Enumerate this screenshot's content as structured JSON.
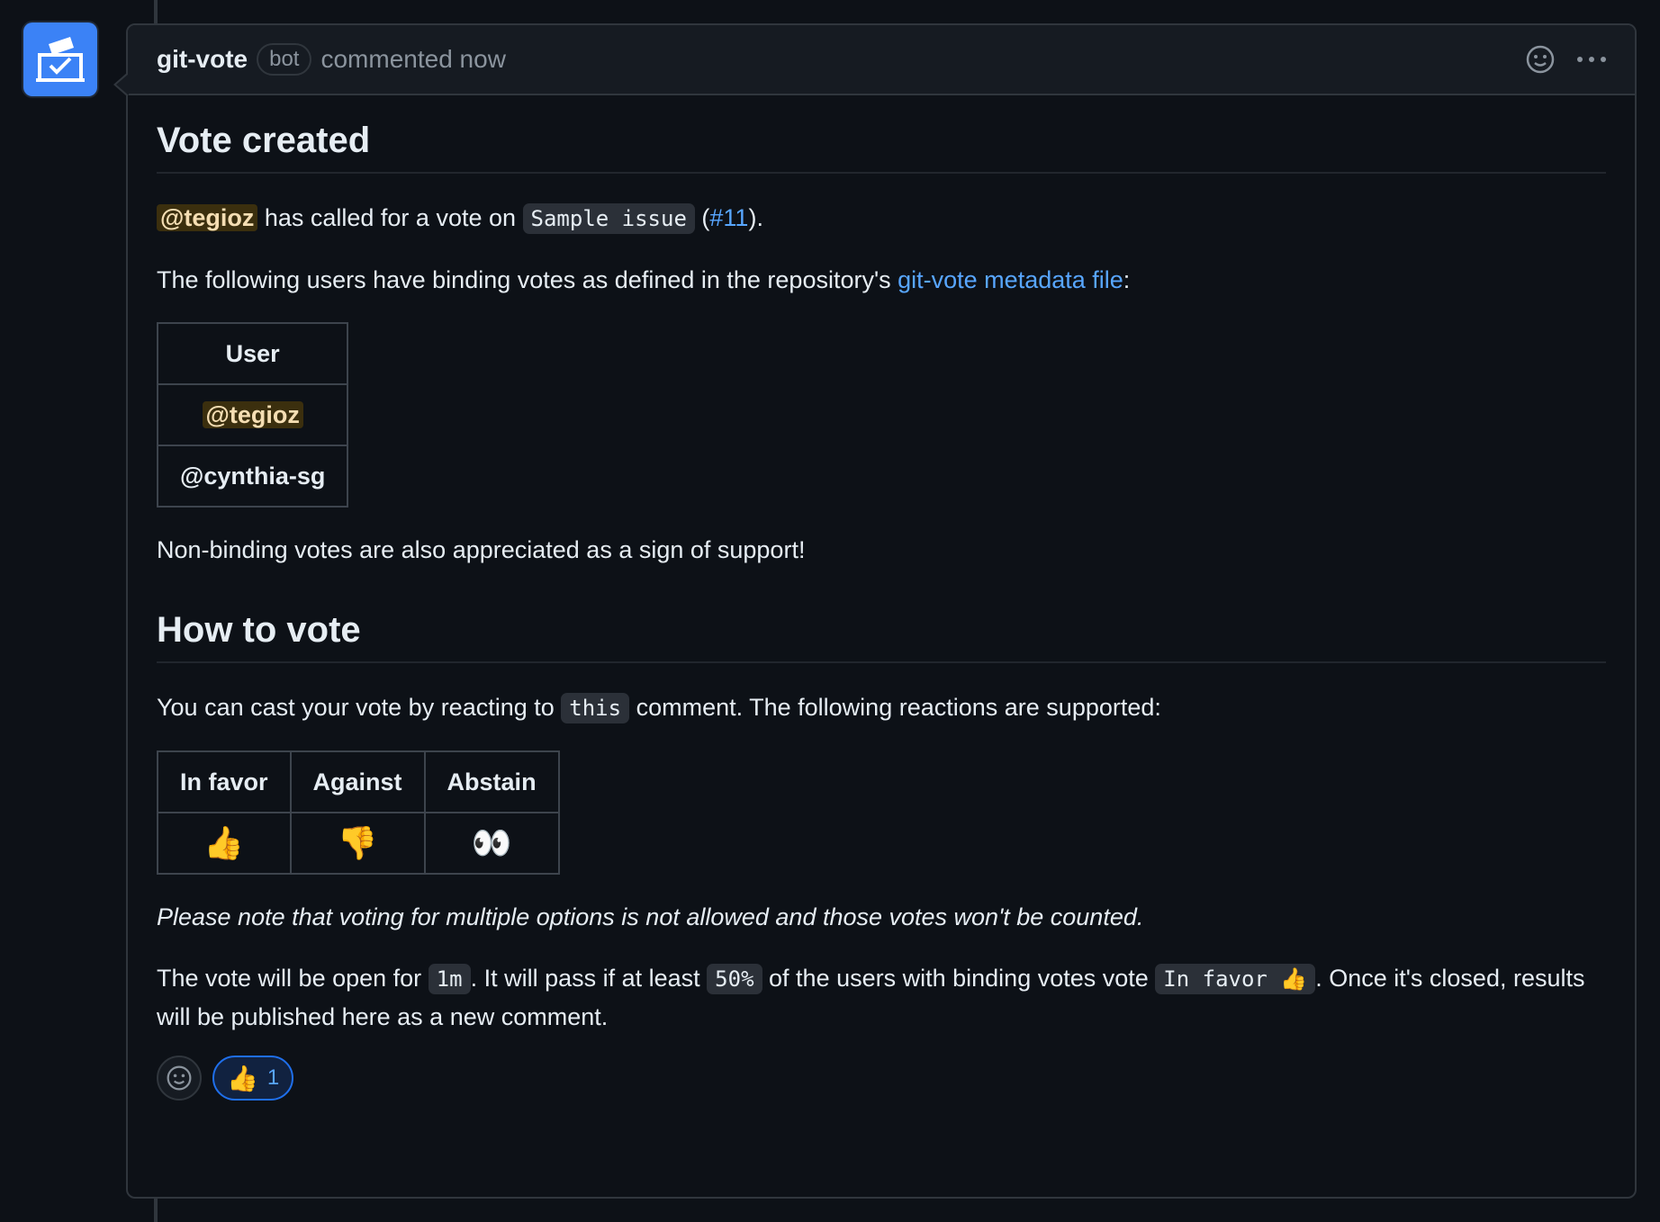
{
  "comment": {
    "author": "git-vote",
    "badge": "bot",
    "meta": "commented now"
  },
  "section1": {
    "heading": "Vote created",
    "mention": "@tegioz",
    "text_called": " has called for a vote on ",
    "issue_code": "Sample issue",
    "paren_open": " (",
    "issue_link": "#11",
    "paren_close": ")."
  },
  "binding": {
    "text_before": "The following users have binding votes as defined in the repository's ",
    "link": "git-vote metadata file",
    "text_after": ":",
    "table_header": "User",
    "users": [
      "@tegioz",
      "@cynthia-sg"
    ]
  },
  "nonbinding_text": "Non-binding votes are also appreciated as a sign of support!",
  "section2": {
    "heading": "How to vote",
    "text_before": "You can cast your vote by reacting to ",
    "code": "this",
    "text_after": " comment. The following reactions are supported:",
    "table": {
      "headers": [
        "In favor",
        "Against",
        "Abstain"
      ],
      "emojis": [
        "👍",
        "👎",
        "👀"
      ]
    },
    "note": "Please note that voting for multiple options is not allowed and those votes won't be counted.",
    "open_text1": "The vote will be open for ",
    "duration": "1m",
    "open_text2": ". It will pass if at least ",
    "threshold": "50%",
    "open_text3": " of the users with binding votes vote ",
    "favor_code": "In favor 👍",
    "open_text4": ". Once it's closed, results will be published here as a new comment."
  },
  "reactions": {
    "thumbs_emoji": "👍",
    "thumbs_count": "1"
  },
  "icons": {
    "avatar": "ballot-box-icon",
    "emoji_picker": "smiley-icon",
    "more": "kebab-menu-icon"
  }
}
